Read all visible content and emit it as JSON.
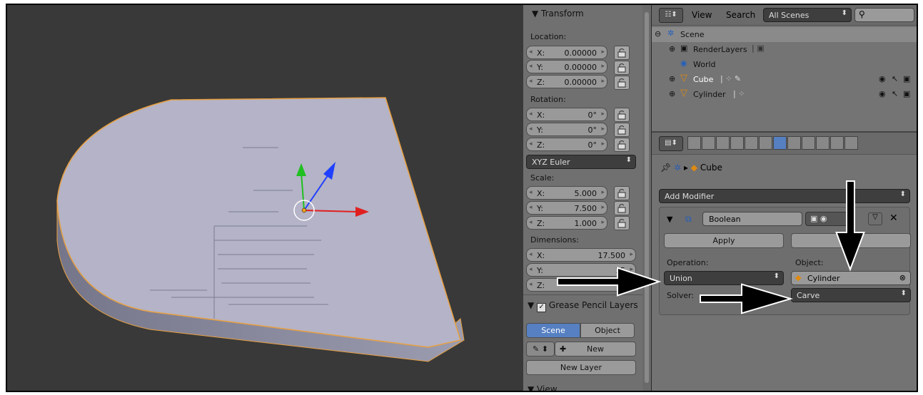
{
  "viewport": {
    "background": "#393939",
    "object_color": "#b7b6c9"
  },
  "transform_panel": {
    "title": "Transform",
    "location_label": "Location:",
    "location": [
      {
        "axis": "X:",
        "value": "0.00000"
      },
      {
        "axis": "Y:",
        "value": "0.00000"
      },
      {
        "axis": "Z:",
        "value": "0.00000"
      }
    ],
    "rotation_label": "Rotation:",
    "rotation": [
      {
        "axis": "X:",
        "value": "0°"
      },
      {
        "axis": "Y:",
        "value": "0°"
      },
      {
        "axis": "Z:",
        "value": "0°"
      }
    ],
    "rotation_mode": "XYZ Euler",
    "scale_label": "Scale:",
    "scale": [
      {
        "axis": "X:",
        "value": "5.000"
      },
      {
        "axis": "Y:",
        "value": "7.500"
      },
      {
        "axis": "Z:",
        "value": "1.000"
      }
    ],
    "dimensions_label": "Dimensions:",
    "dimensions": [
      {
        "axis": "X:",
        "value": "17.500"
      },
      {
        "axis": "Y:",
        "value": "15"
      },
      {
        "axis": "Z:",
        "value": ""
      }
    ]
  },
  "grease_pencil": {
    "title": "Grease Pencil Layers",
    "scene_tab": "Scene",
    "object_tab": "Object",
    "new_label": "New",
    "new_layer_label": "New Layer"
  },
  "view_panel": {
    "title": "View"
  },
  "outliner": {
    "view_menu": "View",
    "search_menu": "Search",
    "scenes_dropdown": "All Scenes",
    "items": [
      {
        "label": "Scene",
        "icon": "scene-icon"
      },
      {
        "label": "RenderLayers",
        "icon": "render-layers-icon"
      },
      {
        "label": "World",
        "icon": "world-icon"
      },
      {
        "label": "Cube",
        "icon": "mesh-object-icon"
      },
      {
        "label": "Cylinder",
        "icon": "mesh-object-icon"
      }
    ]
  },
  "properties": {
    "breadcrumb_object": "Cube",
    "add_modifier": "Add Modifier",
    "modifier_name": "Boolean",
    "apply_label": "Apply",
    "copy_label": "C",
    "operation_label": "Operation:",
    "operation_value": "Union",
    "object_label": "Object:",
    "object_value": "Cylinder",
    "solver_label": "Solver:",
    "solver_value": "Carve"
  },
  "colors": {
    "accent_blue": "#5680c2",
    "selection_orange": "#f0a020"
  }
}
